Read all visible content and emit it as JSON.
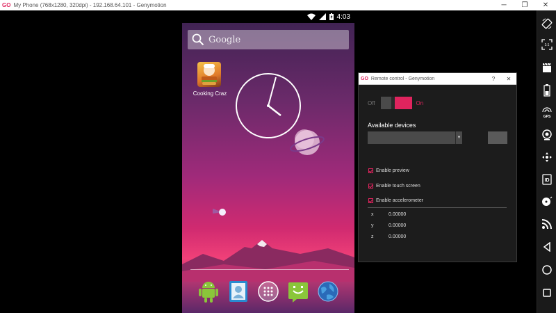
{
  "window": {
    "logo": "GO",
    "title": "My Phone (768x1280, 320dpi) - 192.168.64.101 - Genymotion",
    "minimize": "─",
    "restore": "❐",
    "close": "✕"
  },
  "toolbar": {
    "items": [
      "rotate-icon",
      "scale-1-1-icon",
      "clapperboard-icon",
      "battery-icon",
      "gps-icon",
      "camera-icon",
      "dpad-icon",
      "id-icon",
      "disk-icon",
      "rss-icon",
      "back-icon",
      "home-icon",
      "recent-apps-icon"
    ],
    "gps_label": "GPS",
    "id_label": "ID",
    "scale_label": "1:1"
  },
  "phone": {
    "status": {
      "time": "4:03"
    },
    "search_placeholder": "Google",
    "app": {
      "label": "Cooking Craz"
    },
    "dock": [
      "android-icon",
      "contacts-icon",
      "app-drawer-icon",
      "messaging-icon",
      "browser-icon"
    ]
  },
  "dialog": {
    "logo": "GO",
    "title": "Remote control - Genymotion",
    "help": "?",
    "close": "✕",
    "toggle_off": "Off",
    "toggle_on": "On",
    "available_devices": "Available devices",
    "checks": [
      {
        "label": "Enable preview",
        "checked": true
      },
      {
        "label": "Enable touch screen",
        "checked": true
      },
      {
        "label": "Enable accelerometer",
        "checked": true
      }
    ],
    "axes": [
      {
        "name": "x",
        "value": "0.00000"
      },
      {
        "name": "y",
        "value": "0.00000"
      },
      {
        "name": "z",
        "value": "0.00000"
      }
    ]
  },
  "colors": {
    "accent": "#e0245e"
  }
}
